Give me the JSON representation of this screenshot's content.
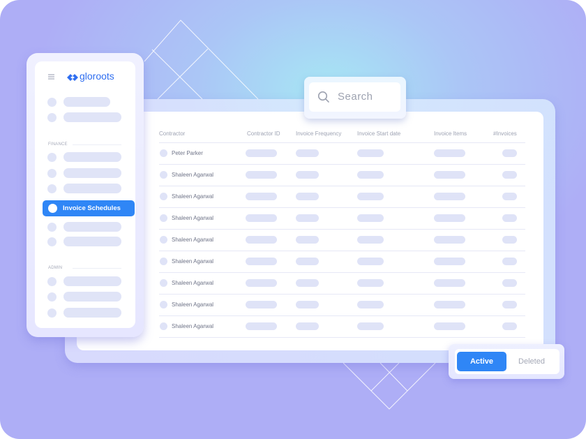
{
  "brand": {
    "name": "gloroots",
    "color": "#2f6ef0"
  },
  "search": {
    "placeholder": "Search"
  },
  "sidebar": {
    "sections": [
      {
        "label": "FINANCE"
      },
      {
        "label": "ADMIN"
      }
    ],
    "active_item": {
      "label": "Invoice Schedules"
    },
    "accent": "#2f86f6"
  },
  "table": {
    "columns": [
      "Contractor",
      "Contractor ID",
      "Invoice Frequency",
      "Invoice Start date",
      "Invoice Items",
      "#Invoices"
    ],
    "rows": [
      {
        "contractor": "Peter Parker"
      },
      {
        "contractor": "Shaleen Agarwal"
      },
      {
        "contractor": "Shaleen Agarwal"
      },
      {
        "contractor": "Shaleen Agarwal"
      },
      {
        "contractor": "Shaleen Agarwal"
      },
      {
        "contractor": "Shaleen Agarwal"
      },
      {
        "contractor": "Shaleen Agarwal"
      },
      {
        "contractor": "Shaleen Agarwal"
      },
      {
        "contractor": "Shaleen Agarwal"
      }
    ]
  },
  "status_toggle": {
    "active_label": "Active",
    "deleted_label": "Deleted",
    "selected": "Active"
  }
}
